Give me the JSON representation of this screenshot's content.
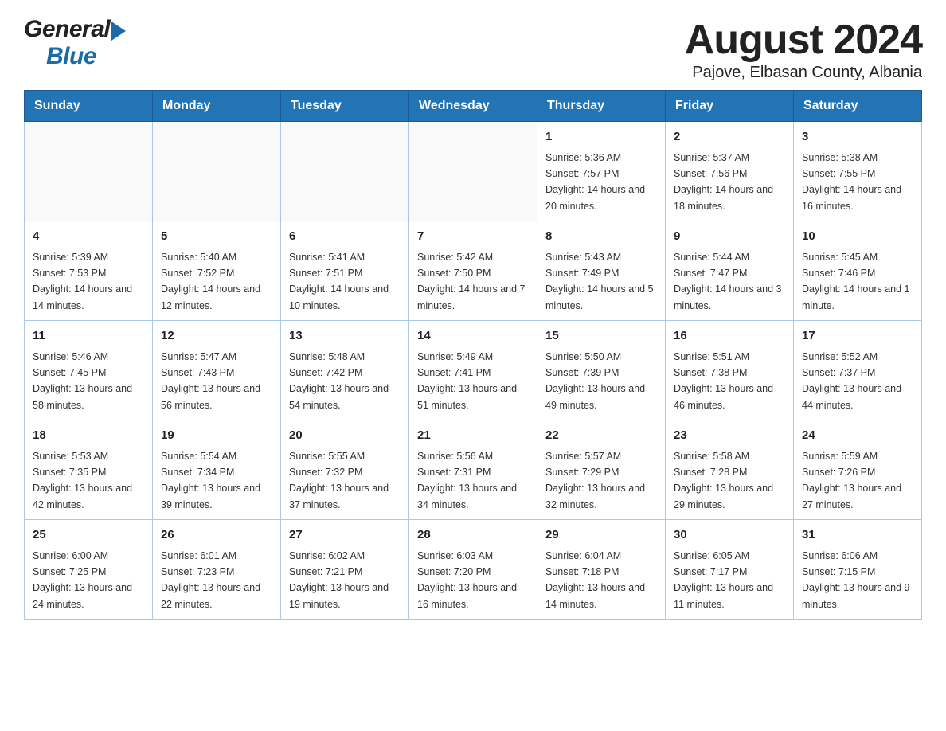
{
  "header": {
    "title": "August 2024",
    "location": "Pajove, Elbasan County, Albania",
    "logo_general": "General",
    "logo_blue": "Blue"
  },
  "weekdays": [
    "Sunday",
    "Monday",
    "Tuesday",
    "Wednesday",
    "Thursday",
    "Friday",
    "Saturday"
  ],
  "weeks": [
    [
      {
        "day": "",
        "info": ""
      },
      {
        "day": "",
        "info": ""
      },
      {
        "day": "",
        "info": ""
      },
      {
        "day": "",
        "info": ""
      },
      {
        "day": "1",
        "info": "Sunrise: 5:36 AM\nSunset: 7:57 PM\nDaylight: 14 hours and 20 minutes."
      },
      {
        "day": "2",
        "info": "Sunrise: 5:37 AM\nSunset: 7:56 PM\nDaylight: 14 hours and 18 minutes."
      },
      {
        "day": "3",
        "info": "Sunrise: 5:38 AM\nSunset: 7:55 PM\nDaylight: 14 hours and 16 minutes."
      }
    ],
    [
      {
        "day": "4",
        "info": "Sunrise: 5:39 AM\nSunset: 7:53 PM\nDaylight: 14 hours and 14 minutes."
      },
      {
        "day": "5",
        "info": "Sunrise: 5:40 AM\nSunset: 7:52 PM\nDaylight: 14 hours and 12 minutes."
      },
      {
        "day": "6",
        "info": "Sunrise: 5:41 AM\nSunset: 7:51 PM\nDaylight: 14 hours and 10 minutes."
      },
      {
        "day": "7",
        "info": "Sunrise: 5:42 AM\nSunset: 7:50 PM\nDaylight: 14 hours and 7 minutes."
      },
      {
        "day": "8",
        "info": "Sunrise: 5:43 AM\nSunset: 7:49 PM\nDaylight: 14 hours and 5 minutes."
      },
      {
        "day": "9",
        "info": "Sunrise: 5:44 AM\nSunset: 7:47 PM\nDaylight: 14 hours and 3 minutes."
      },
      {
        "day": "10",
        "info": "Sunrise: 5:45 AM\nSunset: 7:46 PM\nDaylight: 14 hours and 1 minute."
      }
    ],
    [
      {
        "day": "11",
        "info": "Sunrise: 5:46 AM\nSunset: 7:45 PM\nDaylight: 13 hours and 58 minutes."
      },
      {
        "day": "12",
        "info": "Sunrise: 5:47 AM\nSunset: 7:43 PM\nDaylight: 13 hours and 56 minutes."
      },
      {
        "day": "13",
        "info": "Sunrise: 5:48 AM\nSunset: 7:42 PM\nDaylight: 13 hours and 54 minutes."
      },
      {
        "day": "14",
        "info": "Sunrise: 5:49 AM\nSunset: 7:41 PM\nDaylight: 13 hours and 51 minutes."
      },
      {
        "day": "15",
        "info": "Sunrise: 5:50 AM\nSunset: 7:39 PM\nDaylight: 13 hours and 49 minutes."
      },
      {
        "day": "16",
        "info": "Sunrise: 5:51 AM\nSunset: 7:38 PM\nDaylight: 13 hours and 46 minutes."
      },
      {
        "day": "17",
        "info": "Sunrise: 5:52 AM\nSunset: 7:37 PM\nDaylight: 13 hours and 44 minutes."
      }
    ],
    [
      {
        "day": "18",
        "info": "Sunrise: 5:53 AM\nSunset: 7:35 PM\nDaylight: 13 hours and 42 minutes."
      },
      {
        "day": "19",
        "info": "Sunrise: 5:54 AM\nSunset: 7:34 PM\nDaylight: 13 hours and 39 minutes."
      },
      {
        "day": "20",
        "info": "Sunrise: 5:55 AM\nSunset: 7:32 PM\nDaylight: 13 hours and 37 minutes."
      },
      {
        "day": "21",
        "info": "Sunrise: 5:56 AM\nSunset: 7:31 PM\nDaylight: 13 hours and 34 minutes."
      },
      {
        "day": "22",
        "info": "Sunrise: 5:57 AM\nSunset: 7:29 PM\nDaylight: 13 hours and 32 minutes."
      },
      {
        "day": "23",
        "info": "Sunrise: 5:58 AM\nSunset: 7:28 PM\nDaylight: 13 hours and 29 minutes."
      },
      {
        "day": "24",
        "info": "Sunrise: 5:59 AM\nSunset: 7:26 PM\nDaylight: 13 hours and 27 minutes."
      }
    ],
    [
      {
        "day": "25",
        "info": "Sunrise: 6:00 AM\nSunset: 7:25 PM\nDaylight: 13 hours and 24 minutes."
      },
      {
        "day": "26",
        "info": "Sunrise: 6:01 AM\nSunset: 7:23 PM\nDaylight: 13 hours and 22 minutes."
      },
      {
        "day": "27",
        "info": "Sunrise: 6:02 AM\nSunset: 7:21 PM\nDaylight: 13 hours and 19 minutes."
      },
      {
        "day": "28",
        "info": "Sunrise: 6:03 AM\nSunset: 7:20 PM\nDaylight: 13 hours and 16 minutes."
      },
      {
        "day": "29",
        "info": "Sunrise: 6:04 AM\nSunset: 7:18 PM\nDaylight: 13 hours and 14 minutes."
      },
      {
        "day": "30",
        "info": "Sunrise: 6:05 AM\nSunset: 7:17 PM\nDaylight: 13 hours and 11 minutes."
      },
      {
        "day": "31",
        "info": "Sunrise: 6:06 AM\nSunset: 7:15 PM\nDaylight: 13 hours and 9 minutes."
      }
    ]
  ]
}
